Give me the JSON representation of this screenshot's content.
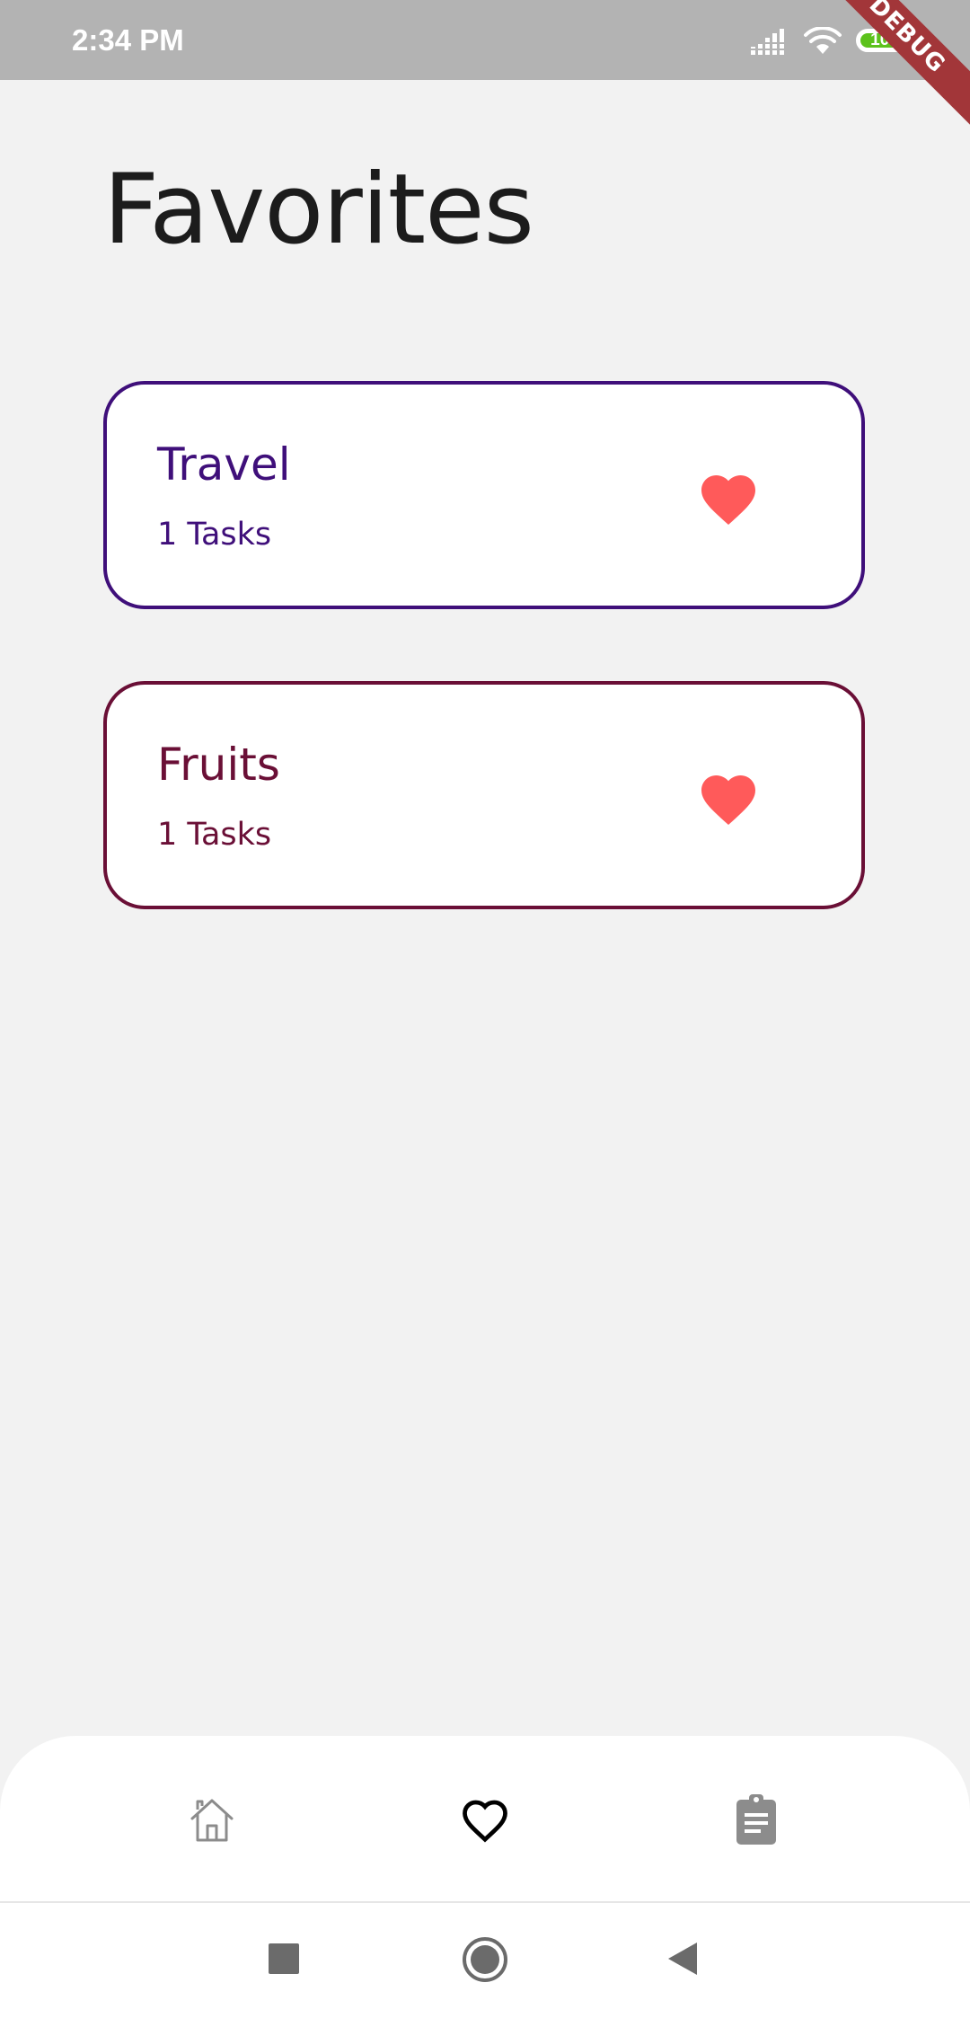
{
  "status_bar": {
    "time": "2:34 PM",
    "battery": "100",
    "debug_label": "DEBUG"
  },
  "page": {
    "title": "Favorites"
  },
  "favorites": [
    {
      "name": "Travel",
      "count": "1 Tasks",
      "color": "#3f0f7a",
      "heart_color": "#ff5a5a"
    },
    {
      "name": "Fruits",
      "count": "1 Tasks",
      "color": "#6a0f36",
      "heart_color": "#ff5a5a"
    }
  ],
  "bottom_nav": {
    "items": [
      {
        "icon": "home-icon",
        "active": false
      },
      {
        "icon": "heart-outline-icon",
        "active": true
      },
      {
        "icon": "clipboard-icon",
        "active": false
      }
    ]
  },
  "system_nav": {
    "buttons": [
      "recents-icon",
      "home-circle-icon",
      "back-triangle-icon"
    ]
  }
}
